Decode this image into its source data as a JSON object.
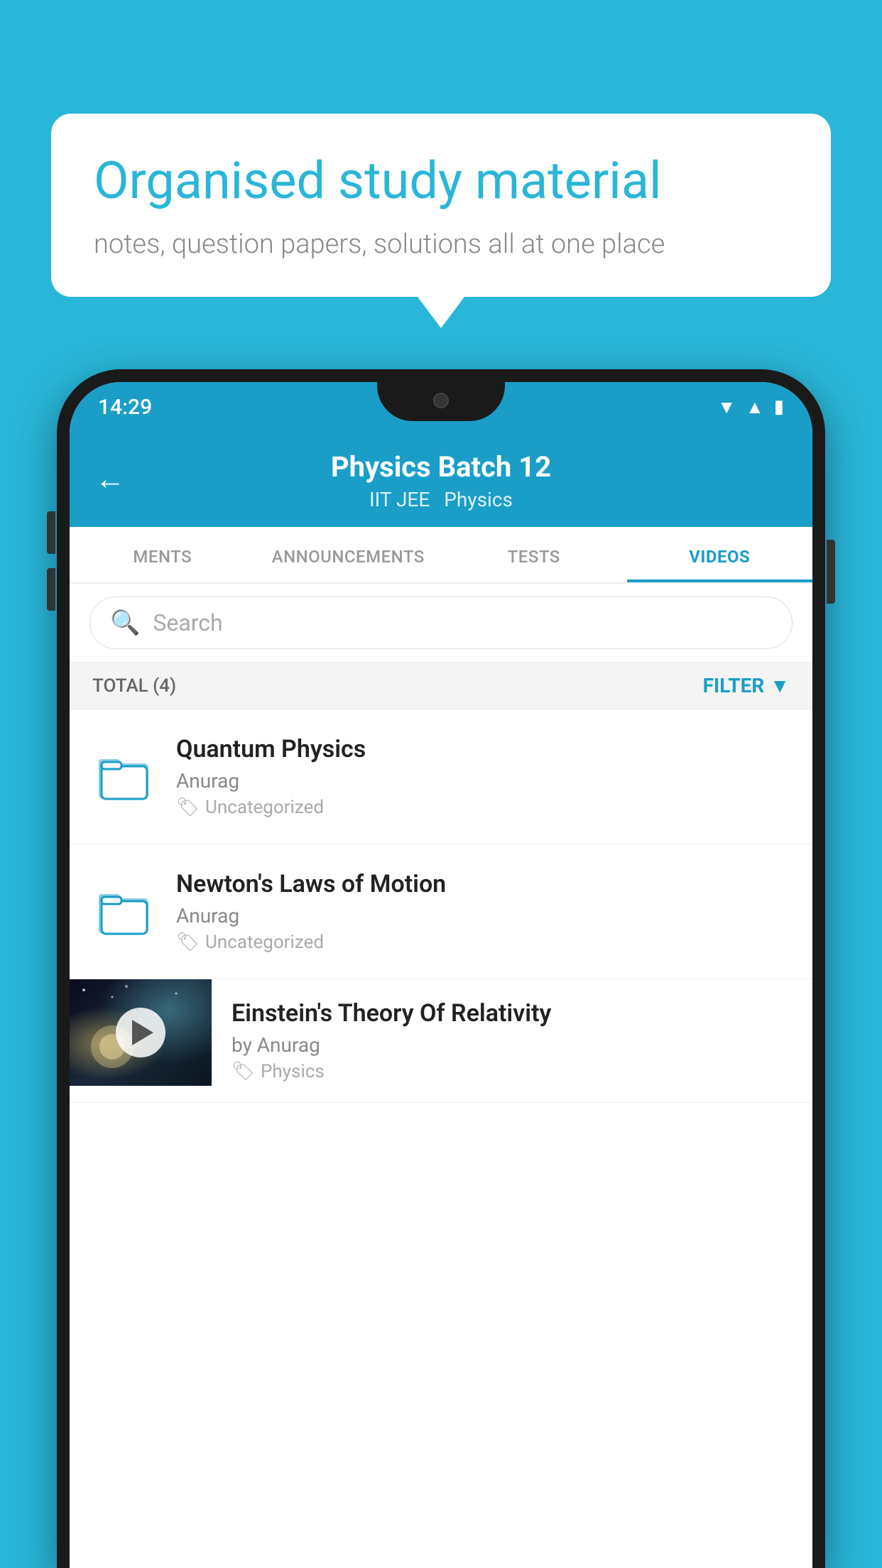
{
  "background": {
    "color": "#29b6d8"
  },
  "speech_bubble": {
    "title": "Organised study material",
    "subtitle": "notes, question papers, solutions all at one place"
  },
  "status_bar": {
    "time": "14:29",
    "icons": [
      "wifi",
      "signal",
      "battery"
    ]
  },
  "app_header": {
    "title": "Physics Batch 12",
    "subtitle1": "IIT JEE",
    "subtitle2": "Physics",
    "back_label": "←"
  },
  "tabs": [
    {
      "label": "MENTS",
      "active": false
    },
    {
      "label": "ANNOUNCEMENTS",
      "active": false
    },
    {
      "label": "TESTS",
      "active": false
    },
    {
      "label": "VIDEOS",
      "active": true
    }
  ],
  "search": {
    "placeholder": "Search"
  },
  "filter_bar": {
    "total_label": "TOTAL (4)",
    "filter_label": "FILTER"
  },
  "video_items": [
    {
      "title": "Quantum Physics",
      "author": "Anurag",
      "tag": "Uncategorized",
      "type": "folder"
    },
    {
      "title": "Newton's Laws of Motion",
      "author": "Anurag",
      "tag": "Uncategorized",
      "type": "folder"
    },
    {
      "title": "Einstein's Theory Of Relativity",
      "author": "by Anurag",
      "tag": "Physics",
      "type": "video"
    }
  ]
}
